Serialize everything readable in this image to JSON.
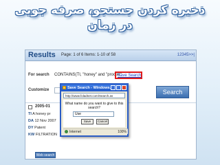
{
  "heading": {
    "line1": "ذخیره کردن جستجو، صرفه جویی",
    "line2": "در زمان"
  },
  "results": {
    "title": "Results",
    "page_info": "Page: 1 of 6  Items: 1-10 of 58",
    "pager": "12345>>|",
    "for_search_label": "For search",
    "query": "CONTAINS(TI, \"honey\" and \"procter\"",
    "save_search_link": "Save Search",
    "customize_label": "Customize",
    "search_button": "Search"
  },
  "record": {
    "date": "2005-01",
    "ti_label": "TI",
    "ti_value": "A honey pr",
    "da_label": "DA",
    "da_value": "12 Nov 2007",
    "dp_label": "DY",
    "dp_value": "Patent",
    "kw_label": "KW",
    "kw_value": "FILTRATION",
    "web_search": "Web search"
  },
  "popup": {
    "title": "Save Search - Windows...",
    "url": "http://www.foladnet.com/Search.as",
    "question": "What name do you want to give to this search?",
    "input_value": "Use",
    "save_button": "Save",
    "cancel_button": "Cancel",
    "status_text": "Internet",
    "zoom": "100%"
  },
  "colors": {
    "heading_outline": "#2c5f9e",
    "highlight": "#e01b1b",
    "accent": "#1f4b85"
  }
}
